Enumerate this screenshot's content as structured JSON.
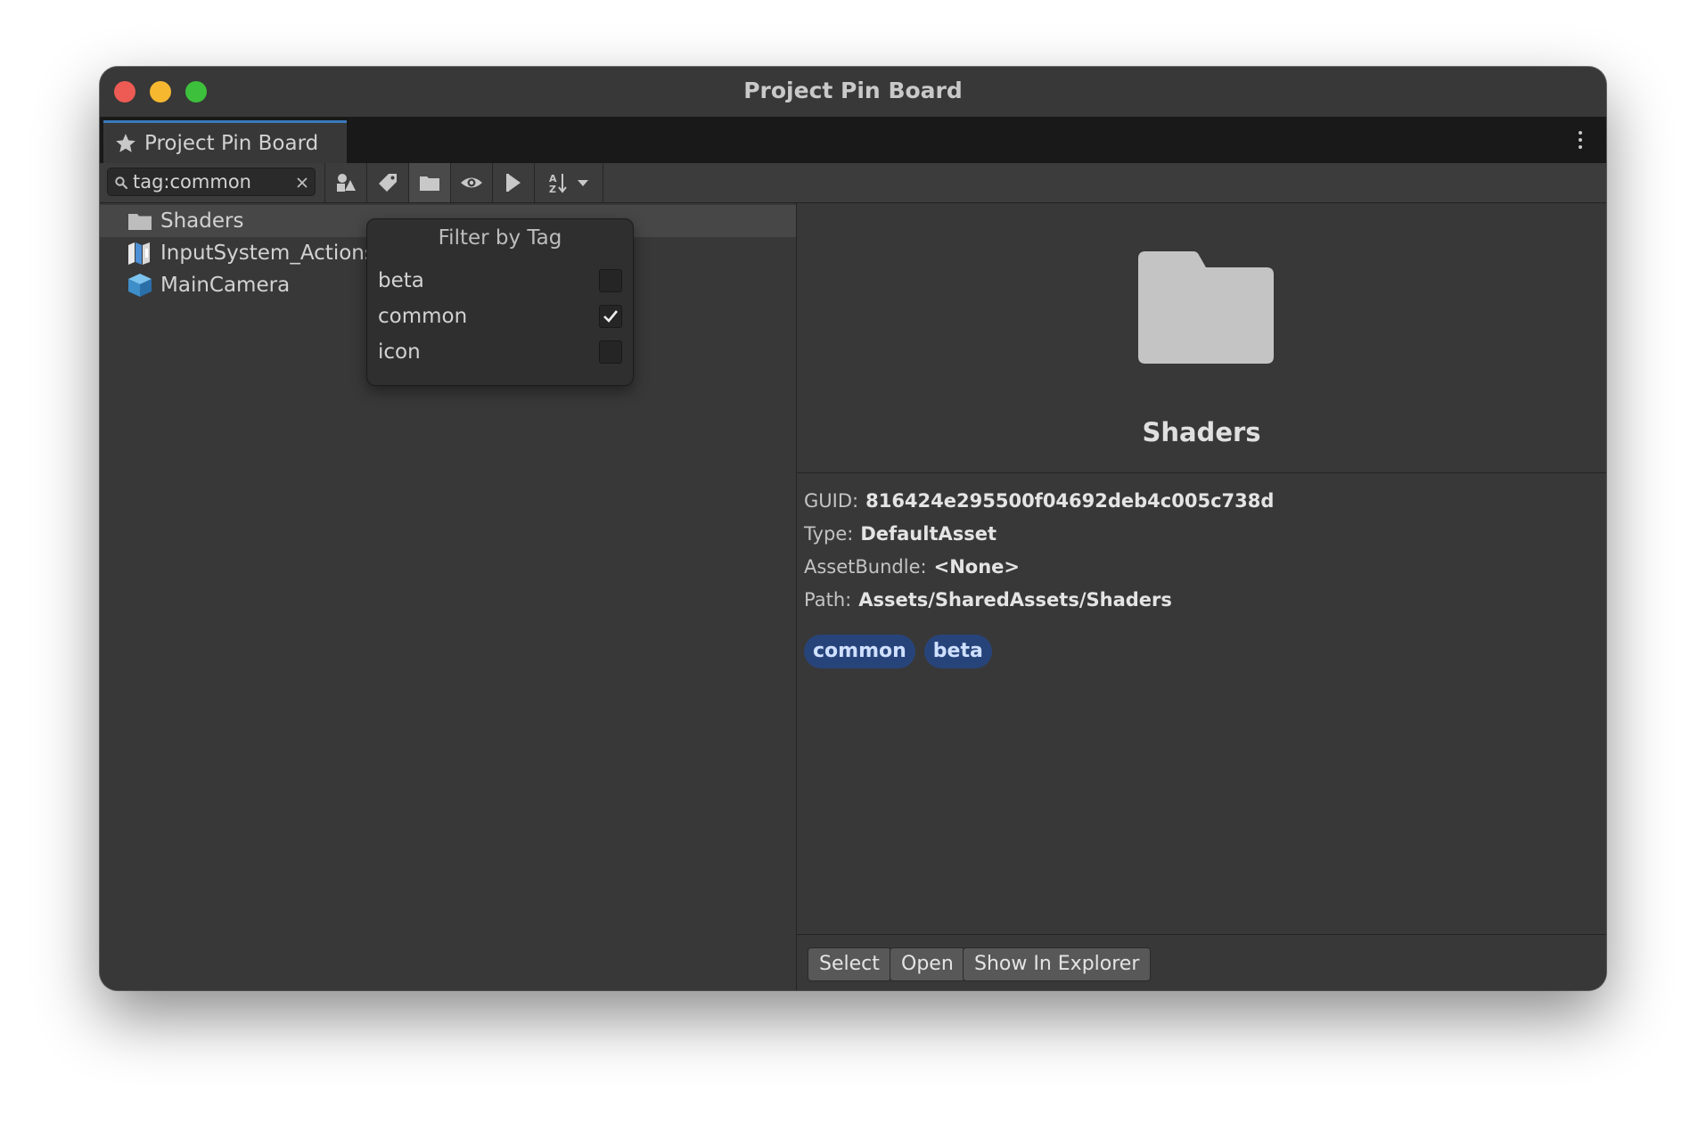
{
  "window": {
    "title": "Project Pin Board"
  },
  "tab": {
    "label": "Project Pin Board"
  },
  "search": {
    "value": "tag:common"
  },
  "toolbar": {
    "buttons": [
      {
        "icon": "shapes-icon"
      },
      {
        "icon": "tag-icon"
      },
      {
        "icon": "folder-icon",
        "active": true
      },
      {
        "icon": "eye-icon"
      },
      {
        "icon": "pointer-icon"
      },
      {
        "icon": "sort-az-icon"
      }
    ]
  },
  "items": [
    {
      "label": "Shaders",
      "icon": "folder-icon",
      "selected": true
    },
    {
      "label": "InputSystem_Actions",
      "icon": "input-actions-icon"
    },
    {
      "label": "MainCamera",
      "icon": "prefab-cube-icon"
    }
  ],
  "filter_popup": {
    "title": "Filter by Tag",
    "tags": [
      {
        "label": "beta",
        "checked": false
      },
      {
        "label": "common",
        "checked": true
      },
      {
        "label": "icon",
        "checked": false
      }
    ]
  },
  "details": {
    "name": "Shaders",
    "guid_label": "GUID:",
    "guid": "816424e295500f04692deb4c005c738d",
    "type_label": "Type:",
    "type": "DefaultAsset",
    "bundle_label": "AssetBundle:",
    "bundle": "<None>",
    "path_label": "Path:",
    "path": "Assets/SharedAssets/Shaders",
    "tags": [
      "common",
      "beta"
    ]
  },
  "footer": {
    "select_label": "Select",
    "open_label": "Open",
    "explorer_label": "Show In Explorer"
  },
  "colors": {
    "accent": "#3a79bb",
    "tag_bg": "#27447a",
    "background": "#383838"
  }
}
